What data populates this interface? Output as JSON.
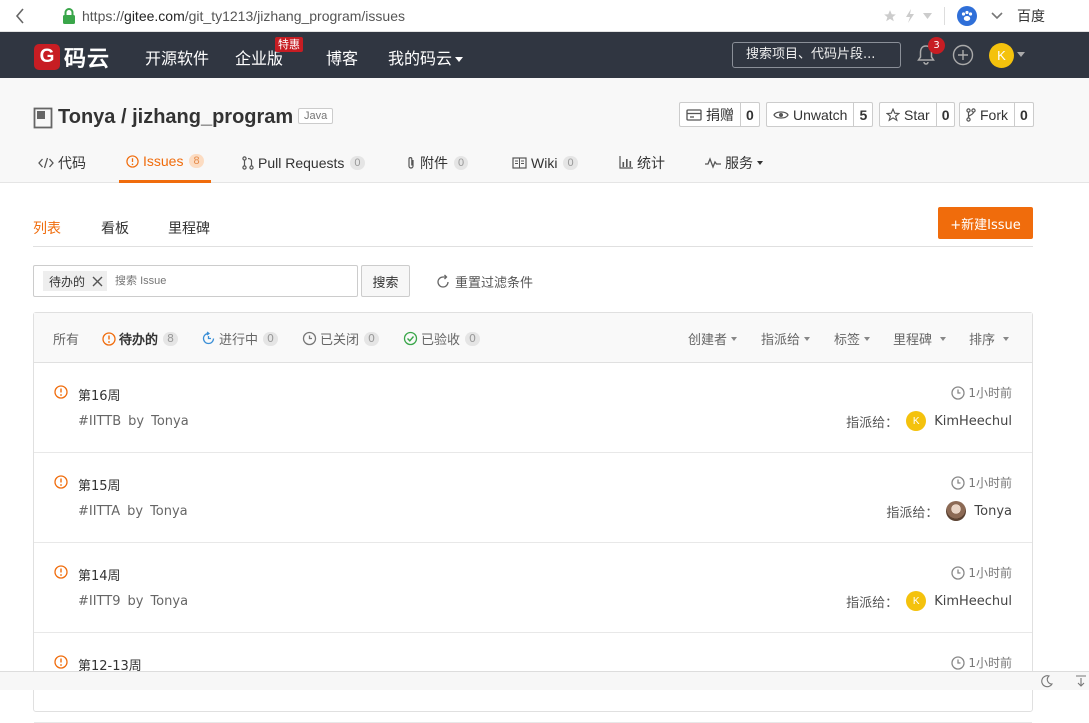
{
  "browser": {
    "url_prefix": "https://",
    "url_host": "gitee.com",
    "url_path": "/git_ty1213/jizhang_program/issues",
    "search_engine": "百度"
  },
  "header": {
    "logo": "码云",
    "logo_mark": "G",
    "nav": [
      "开源软件",
      "企业版",
      "博客",
      "我的码云"
    ],
    "badge": "特惠",
    "search_placeholder": "搜索项目、代码片段...",
    "notif_count": "3",
    "user_initial": "K"
  },
  "project": {
    "title": "Tonya / jizhang_program",
    "lang": "Java",
    "actions": [
      {
        "label": "捐赠",
        "count": "0"
      },
      {
        "label": "Unwatch",
        "count": "5"
      },
      {
        "label": "Star",
        "count": "0"
      },
      {
        "label": "Fork",
        "count": "0"
      }
    ],
    "tabs": [
      {
        "label": "代码"
      },
      {
        "label": "Issues",
        "count": "8"
      },
      {
        "label": "Pull Requests",
        "count": "0"
      },
      {
        "label": "附件",
        "count": "0"
      },
      {
        "label": "Wiki",
        "count": "0"
      },
      {
        "label": "统计"
      },
      {
        "label": "服务"
      }
    ]
  },
  "subnav": {
    "tabs": [
      "列表",
      "看板",
      "里程碑"
    ],
    "new_issue": "+新建Issue"
  },
  "filter": {
    "chip": "待办的",
    "placeholder": "搜索 Issue",
    "search_button": "搜索",
    "reset": "重置过滤条件"
  },
  "list": {
    "statuses": [
      {
        "label": "所有"
      },
      {
        "label": "待办的",
        "count": "8"
      },
      {
        "label": "进行中",
        "count": "0"
      },
      {
        "label": "已关闭",
        "count": "0"
      },
      {
        "label": "已验收",
        "count": "0"
      }
    ],
    "dropdowns": [
      "创建者",
      "指派给",
      "标签",
      "里程碑",
      "排序"
    ],
    "assign_label": "指派给：",
    "by": "by",
    "issues": [
      {
        "title": "第16周",
        "id": "#IITTB",
        "author": "Tonya",
        "time": "1小时前",
        "assignee": "KimHeechul",
        "assignee_initial": "K"
      },
      {
        "title": "第15周",
        "id": "#IITTA",
        "author": "Tonya",
        "time": "1小时前",
        "assignee": "Tonya",
        "assignee_initial": ""
      },
      {
        "title": "第14周",
        "id": "#IITT9",
        "author": "Tonya",
        "time": "1小时前",
        "assignee": "KimHeechul",
        "assignee_initial": "K"
      },
      {
        "title": "第12-13周",
        "time": "1小时前"
      }
    ]
  },
  "colors": {
    "accent": "#f06c0c",
    "header_bg": "#303641",
    "brand_red": "#c71d23"
  }
}
